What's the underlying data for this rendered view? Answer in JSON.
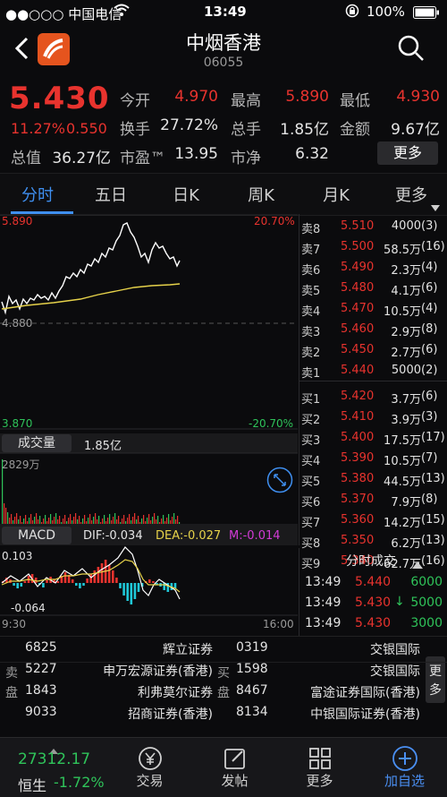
{
  "status": {
    "carrier": "●●○○○ 中国电信",
    "time": "13:49",
    "battery": "100%"
  },
  "header": {
    "title": "中烟香港",
    "code": "06055"
  },
  "quote": {
    "price": "5.430",
    "change_pct": "11.27%",
    "change": "0.550",
    "open_label": "今开",
    "open": "4.970",
    "high_label": "最高",
    "high": "5.890",
    "low_label": "最低",
    "low": "4.930",
    "turnover_label": "换手",
    "turnover": "27.72%",
    "volume_label": "总手",
    "volume": "1.85亿",
    "amount_label": "金额",
    "amount": "9.67亿",
    "mktcap_label": "总值",
    "mktcap": "36.27亿",
    "pe_label": "市盈™",
    "pe": "13.95",
    "pb_label": "市净",
    "pb": "6.32",
    "more": "更多"
  },
  "tabs": [
    "分时",
    "五日",
    "日K",
    "周K",
    "月K",
    "更多"
  ],
  "chart": {
    "top_price": "5.890",
    "top_pct": "20.70%",
    "mid_price": "4.880",
    "bottom_price": "3.870",
    "bottom_pct": "-20.70%",
    "vol_label": "成交量",
    "vol_total": "1.85亿",
    "vol_max": "2829万",
    "macd_label": "MACD",
    "dif": "DIF:-0.034",
    "dea": "DEA:-0.027",
    "m": "M:-0.014",
    "macd_top": "0.103",
    "macd_bottom": "-0.064",
    "t_start": "9:30",
    "t_end": "16:00",
    "colors": {
      "up": "#e8332e",
      "down": "#2fc35a",
      "price_line": "#ffffff",
      "avg_line": "#e6d24a",
      "hist_down": "#1fc8d8"
    }
  },
  "book": {
    "asks": [
      {
        "label": "卖8",
        "price": "5.510",
        "vol": "4000",
        "n": "(3)"
      },
      {
        "label": "卖7",
        "price": "5.500",
        "vol": "58.5万",
        "n": "(16)"
      },
      {
        "label": "卖6",
        "price": "5.490",
        "vol": "2.3万",
        "n": "(4)"
      },
      {
        "label": "卖5",
        "price": "5.480",
        "vol": "4.1万",
        "n": "(6)"
      },
      {
        "label": "卖4",
        "price": "5.470",
        "vol": "10.5万",
        "n": "(4)"
      },
      {
        "label": "卖3",
        "price": "5.460",
        "vol": "2.9万",
        "n": "(8)"
      },
      {
        "label": "卖2",
        "price": "5.450",
        "vol": "2.7万",
        "n": "(6)"
      },
      {
        "label": "卖1",
        "price": "5.440",
        "vol": "5000",
        "n": "(2)"
      }
    ],
    "bids": [
      {
        "label": "买1",
        "price": "5.420",
        "vol": "3.7万",
        "n": "(6)"
      },
      {
        "label": "买2",
        "price": "5.410",
        "vol": "3.9万",
        "n": "(3)"
      },
      {
        "label": "买3",
        "price": "5.400",
        "vol": "17.5万",
        "n": "(17)"
      },
      {
        "label": "买4",
        "price": "5.390",
        "vol": "10.5万",
        "n": "(7)"
      },
      {
        "label": "买5",
        "price": "5.380",
        "vol": "44.5万",
        "n": "(13)"
      },
      {
        "label": "买6",
        "price": "5.370",
        "vol": "7.9万",
        "n": "(8)"
      },
      {
        "label": "买7",
        "price": "5.360",
        "vol": "14.2万",
        "n": "(15)"
      },
      {
        "label": "买8",
        "price": "5.350",
        "vol": "6.2万",
        "n": "(13)"
      },
      {
        "label": "买9",
        "price": "5.340",
        "vol": "62.7万",
        "n": "(16)"
      }
    ]
  },
  "trades": {
    "title": "分时成交",
    "rows": [
      {
        "time": "13:49",
        "price": "5.440",
        "arrow": "",
        "vol": "6000"
      },
      {
        "time": "13:49",
        "price": "5.430",
        "arrow": "↓",
        "vol": "5000"
      },
      {
        "time": "13:49",
        "price": "5.430",
        "arrow": "",
        "vol": "3000"
      }
    ]
  },
  "brokers": {
    "sell_label_1": "卖",
    "sell_label_2": "盘",
    "buy_label_1": "买",
    "buy_label_2": "盘",
    "more_1": "更",
    "more_2": "多",
    "sell": [
      {
        "id": "6825",
        "name": "辉立证券"
      },
      {
        "id": "5227",
        "name": "申万宏源证券(香港)"
      },
      {
        "id": "1843",
        "name": "利弗莫尔证券"
      },
      {
        "id": "9033",
        "name": "招商证券(香港)"
      }
    ],
    "buy": [
      {
        "id": "0319",
        "name": "交银国际"
      },
      {
        "id": "1598",
        "name": "交银国际"
      },
      {
        "id": "8467",
        "name": "富途证券国际(香港)"
      },
      {
        "id": "8134",
        "name": "中银国际证券(香港)"
      }
    ]
  },
  "bottom": {
    "index_value": "27312.17",
    "index_name": "恒生",
    "index_change": "-1.72%",
    "trade": "交易",
    "post": "发帖",
    "more": "更多",
    "add": "加自选"
  }
}
